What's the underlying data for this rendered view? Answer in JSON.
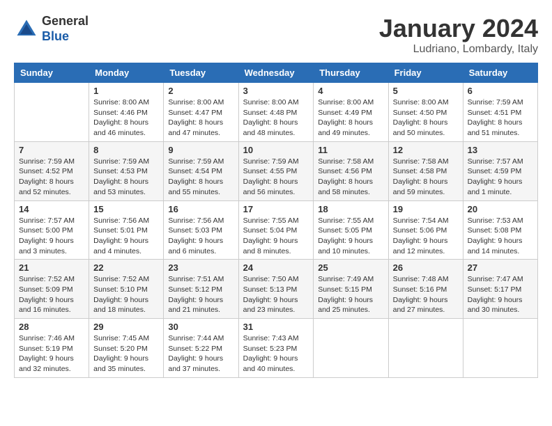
{
  "header": {
    "logo_general": "General",
    "logo_blue": "Blue",
    "month": "January 2024",
    "location": "Ludriano, Lombardy, Italy"
  },
  "days": [
    "Sunday",
    "Monday",
    "Tuesday",
    "Wednesday",
    "Thursday",
    "Friday",
    "Saturday"
  ],
  "weeks": [
    [
      {
        "date": "",
        "sunrise": "",
        "sunset": "",
        "daylight": ""
      },
      {
        "date": "1",
        "sunrise": "Sunrise: 8:00 AM",
        "sunset": "Sunset: 4:46 PM",
        "daylight": "Daylight: 8 hours and 46 minutes."
      },
      {
        "date": "2",
        "sunrise": "Sunrise: 8:00 AM",
        "sunset": "Sunset: 4:47 PM",
        "daylight": "Daylight: 8 hours and 47 minutes."
      },
      {
        "date": "3",
        "sunrise": "Sunrise: 8:00 AM",
        "sunset": "Sunset: 4:48 PM",
        "daylight": "Daylight: 8 hours and 48 minutes."
      },
      {
        "date": "4",
        "sunrise": "Sunrise: 8:00 AM",
        "sunset": "Sunset: 4:49 PM",
        "daylight": "Daylight: 8 hours and 49 minutes."
      },
      {
        "date": "5",
        "sunrise": "Sunrise: 8:00 AM",
        "sunset": "Sunset: 4:50 PM",
        "daylight": "Daylight: 8 hours and 50 minutes."
      },
      {
        "date": "6",
        "sunrise": "Sunrise: 7:59 AM",
        "sunset": "Sunset: 4:51 PM",
        "daylight": "Daylight: 8 hours and 51 minutes."
      }
    ],
    [
      {
        "date": "7",
        "sunrise": "Sunrise: 7:59 AM",
        "sunset": "Sunset: 4:52 PM",
        "daylight": "Daylight: 8 hours and 52 minutes."
      },
      {
        "date": "8",
        "sunrise": "Sunrise: 7:59 AM",
        "sunset": "Sunset: 4:53 PM",
        "daylight": "Daylight: 8 hours and 53 minutes."
      },
      {
        "date": "9",
        "sunrise": "Sunrise: 7:59 AM",
        "sunset": "Sunset: 4:54 PM",
        "daylight": "Daylight: 8 hours and 55 minutes."
      },
      {
        "date": "10",
        "sunrise": "Sunrise: 7:59 AM",
        "sunset": "Sunset: 4:55 PM",
        "daylight": "Daylight: 8 hours and 56 minutes."
      },
      {
        "date": "11",
        "sunrise": "Sunrise: 7:58 AM",
        "sunset": "Sunset: 4:56 PM",
        "daylight": "Daylight: 8 hours and 58 minutes."
      },
      {
        "date": "12",
        "sunrise": "Sunrise: 7:58 AM",
        "sunset": "Sunset: 4:58 PM",
        "daylight": "Daylight: 8 hours and 59 minutes."
      },
      {
        "date": "13",
        "sunrise": "Sunrise: 7:57 AM",
        "sunset": "Sunset: 4:59 PM",
        "daylight": "Daylight: 9 hours and 1 minute."
      }
    ],
    [
      {
        "date": "14",
        "sunrise": "Sunrise: 7:57 AM",
        "sunset": "Sunset: 5:00 PM",
        "daylight": "Daylight: 9 hours and 3 minutes."
      },
      {
        "date": "15",
        "sunrise": "Sunrise: 7:56 AM",
        "sunset": "Sunset: 5:01 PM",
        "daylight": "Daylight: 9 hours and 4 minutes."
      },
      {
        "date": "16",
        "sunrise": "Sunrise: 7:56 AM",
        "sunset": "Sunset: 5:03 PM",
        "daylight": "Daylight: 9 hours and 6 minutes."
      },
      {
        "date": "17",
        "sunrise": "Sunrise: 7:55 AM",
        "sunset": "Sunset: 5:04 PM",
        "daylight": "Daylight: 9 hours and 8 minutes."
      },
      {
        "date": "18",
        "sunrise": "Sunrise: 7:55 AM",
        "sunset": "Sunset: 5:05 PM",
        "daylight": "Daylight: 9 hours and 10 minutes."
      },
      {
        "date": "19",
        "sunrise": "Sunrise: 7:54 AM",
        "sunset": "Sunset: 5:06 PM",
        "daylight": "Daylight: 9 hours and 12 minutes."
      },
      {
        "date": "20",
        "sunrise": "Sunrise: 7:53 AM",
        "sunset": "Sunset: 5:08 PM",
        "daylight": "Daylight: 9 hours and 14 minutes."
      }
    ],
    [
      {
        "date": "21",
        "sunrise": "Sunrise: 7:52 AM",
        "sunset": "Sunset: 5:09 PM",
        "daylight": "Daylight: 9 hours and 16 minutes."
      },
      {
        "date": "22",
        "sunrise": "Sunrise: 7:52 AM",
        "sunset": "Sunset: 5:10 PM",
        "daylight": "Daylight: 9 hours and 18 minutes."
      },
      {
        "date": "23",
        "sunrise": "Sunrise: 7:51 AM",
        "sunset": "Sunset: 5:12 PM",
        "daylight": "Daylight: 9 hours and 21 minutes."
      },
      {
        "date": "24",
        "sunrise": "Sunrise: 7:50 AM",
        "sunset": "Sunset: 5:13 PM",
        "daylight": "Daylight: 9 hours and 23 minutes."
      },
      {
        "date": "25",
        "sunrise": "Sunrise: 7:49 AM",
        "sunset": "Sunset: 5:15 PM",
        "daylight": "Daylight: 9 hours and 25 minutes."
      },
      {
        "date": "26",
        "sunrise": "Sunrise: 7:48 AM",
        "sunset": "Sunset: 5:16 PM",
        "daylight": "Daylight: 9 hours and 27 minutes."
      },
      {
        "date": "27",
        "sunrise": "Sunrise: 7:47 AM",
        "sunset": "Sunset: 5:17 PM",
        "daylight": "Daylight: 9 hours and 30 minutes."
      }
    ],
    [
      {
        "date": "28",
        "sunrise": "Sunrise: 7:46 AM",
        "sunset": "Sunset: 5:19 PM",
        "daylight": "Daylight: 9 hours and 32 minutes."
      },
      {
        "date": "29",
        "sunrise": "Sunrise: 7:45 AM",
        "sunset": "Sunset: 5:20 PM",
        "daylight": "Daylight: 9 hours and 35 minutes."
      },
      {
        "date": "30",
        "sunrise": "Sunrise: 7:44 AM",
        "sunset": "Sunset: 5:22 PM",
        "daylight": "Daylight: 9 hours and 37 minutes."
      },
      {
        "date": "31",
        "sunrise": "Sunrise: 7:43 AM",
        "sunset": "Sunset: 5:23 PM",
        "daylight": "Daylight: 9 hours and 40 minutes."
      },
      {
        "date": "",
        "sunrise": "",
        "sunset": "",
        "daylight": ""
      },
      {
        "date": "",
        "sunrise": "",
        "sunset": "",
        "daylight": ""
      },
      {
        "date": "",
        "sunrise": "",
        "sunset": "",
        "daylight": ""
      }
    ]
  ]
}
